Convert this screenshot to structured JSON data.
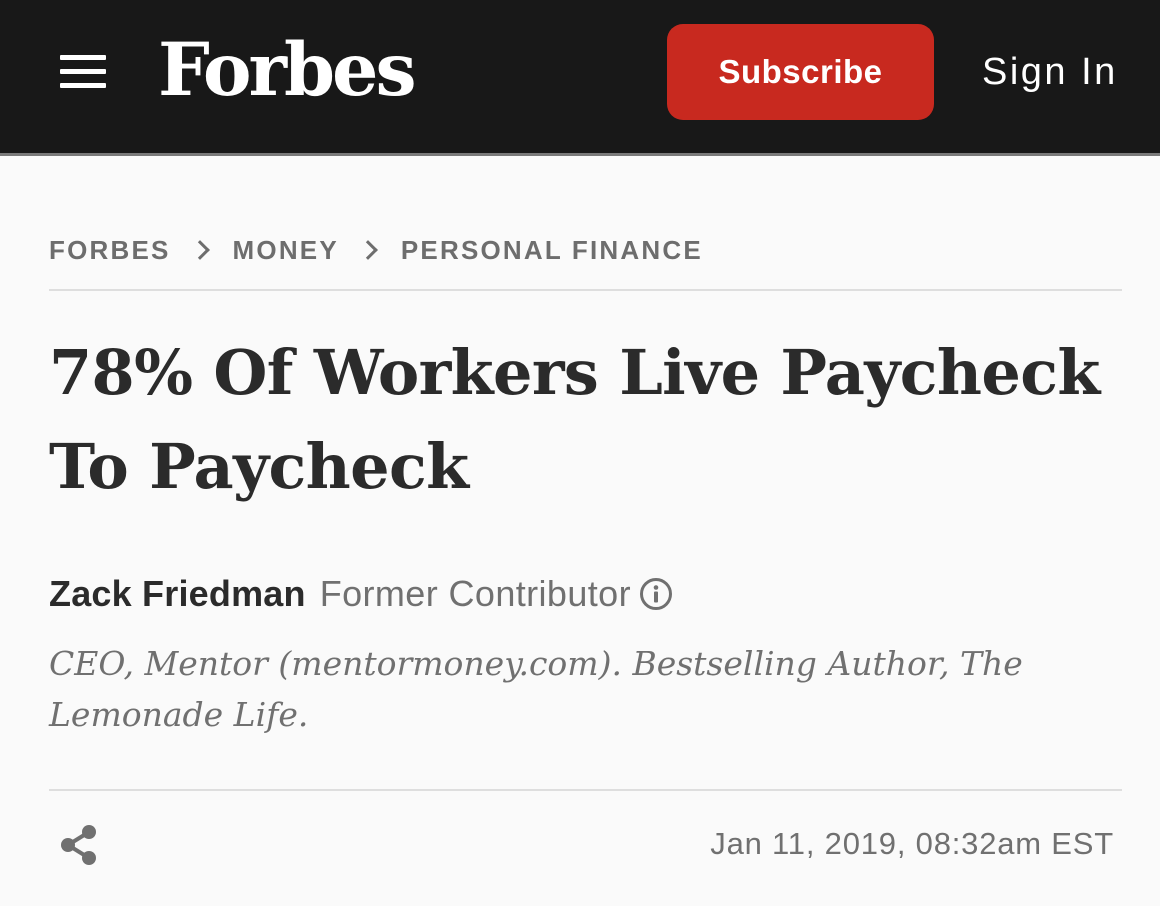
{
  "header": {
    "logo": "Forbes",
    "subscribe_label": "Subscribe",
    "signin_label": "Sign In",
    "accent_color": "#c8291f",
    "background_color": "#181818"
  },
  "breadcrumb": {
    "items": [
      "FORBES",
      "MONEY",
      "PERSONAL FINANCE"
    ]
  },
  "article": {
    "headline": "78% Of Workers Live Paycheck To Paycheck",
    "author": {
      "name": "Zack Friedman",
      "role": "Former Contributor",
      "bio": "CEO, Mentor (mentormoney.com). Bestselling Author, The Lemonade Life."
    },
    "timestamp": "Jan 11, 2019,  08:32am EST"
  },
  "icons": {
    "menu": "hamburger-menu-icon",
    "chevron": "chevron-right-icon",
    "info": "info-circle-icon",
    "share": "share-icon"
  }
}
